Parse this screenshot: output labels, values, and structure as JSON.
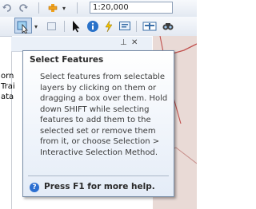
{
  "toolbar": {
    "scale_value": "1:20,000",
    "dropdown_arrow": "▾",
    "dock_pin": "⊥",
    "dock_close": "✕"
  },
  "left_panel": {
    "clipped_lines": [
      "orn",
      "Trai",
      "ata"
    ]
  },
  "tooltip": {
    "title": "Select Features",
    "body": "Select features from selectable layers by clicking on them or dragging a box over them. Hold down SHIFT while selecting features to add them to the selected set or remove them from it, or choose Selection > Interactive Selection Method.",
    "help_glyph": "?",
    "help_text": "Press F1 for more help."
  },
  "icons": [
    "undo-icon",
    "redo-icon",
    "add-data-icon",
    "select-features-icon",
    "clear-selection-icon",
    "select-elements-icon",
    "identify-icon",
    "html-popup-icon",
    "measure-icon",
    "find-icon"
  ],
  "colors": {
    "accent": "#2c6fd1",
    "map_bg": "#e9dad6",
    "map_line": "#c0504d"
  }
}
